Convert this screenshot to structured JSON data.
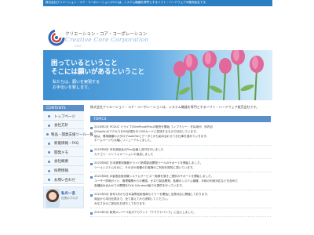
{
  "top_strip": {
    "text": "株式会社クリエーション・コア・コーポレーション(CCC)は、システム機器を専門とするソフト・ハードウェアの販売会社です。"
  },
  "brand": {
    "name_jp": "クリエーション・コア・コーポレーション",
    "name_en": "Creative Core Corporation",
    "abbr": "CCC"
  },
  "hero": {
    "line1": "困っているということ",
    "line2": "そこには願いがあるということ",
    "sub1": "私たちは、願いを実現する",
    "sub2": "お手伝いを致します。"
  },
  "sidebar": {
    "heading": "CONTENTS",
    "items": [
      {
        "label": "トップページ"
      },
      {
        "label": "会社方針"
      },
      {
        "label": "製品・開発支援ツール一覧"
      },
      {
        "label": "新着情報・FAQ"
      },
      {
        "label": "開発メモ"
      },
      {
        "label": "会社概要"
      },
      {
        "label": "採用情報"
      },
      {
        "label": "お問い合わせ"
      }
    ],
    "person": {
      "name": "私の一言",
      "role": "社長のブログ"
    }
  },
  "main": {
    "intro": "株式会社クリエーション・コア・コーポレーションは、システム機器を専門とするソフト・ハードウェア販売会社です。",
    "topics_heading": "TOPICS",
    "news": [
      {
        "lines": [
          "2024年1月 PCDUC ドライブ(SlimProof/Pro)の販売を開始 フィブラリー・を採用が、伴内目",
          "I(Mobile)のアクセスをSD記憶を行うSDカードに変換するもので対応しています。",
          "能は、環境機種のカタログwalkfileとデータとかも組み合わせてお仕事を進めていきます。",
          "ホームページも大幅にリニューアルしました。"
        ]
      },
      {
        "lines": [
          "2023年8月 本社新製品のPlan会議し送付を行いました",
          "カテゴリ・インフォメーションの追加しました"
        ]
      },
      {
        "lines": [
          "2023年8月 日本産業用機器ドライバ新規製品開発ツールのサポートを開始しました。",
          "ツールシステムを元に、そのほか各種のお客様のご利用を既知に頂いています。"
        ]
      },
      {
        "lines": [
          "2021年6月 JE製造技術試験システムサービス一実績を頂きご提供のサポートを開始しました。",
          "ユーザー詳細ガイド、管理機関からの確認、かなり製品開発、各種のシステム機器、手段の利用対応などを含めた",
          "各種組み合わせでの開発をFXからAndroid版での提供を行っています。"
        ]
      },
      {
        "lines": [
          "2021年5月 前年1月から日本高専技術指導セミナーを開始し全員対応に開催しております。",
          "商品から本社社員まで、全て揃えてから説明してください。",
          "みなさまのご参加をお待ちしております。"
        ]
      },
      {
        "lines": [
          "2021年1月 新規メンバー2名がアカウント「クラウドバンク」に加入しました。"
        ]
      }
    ]
  },
  "colors": {
    "accent": "#5b8fc9",
    "strip": "#2a7fc3",
    "sidebar_bg": "#f2f7fc"
  }
}
